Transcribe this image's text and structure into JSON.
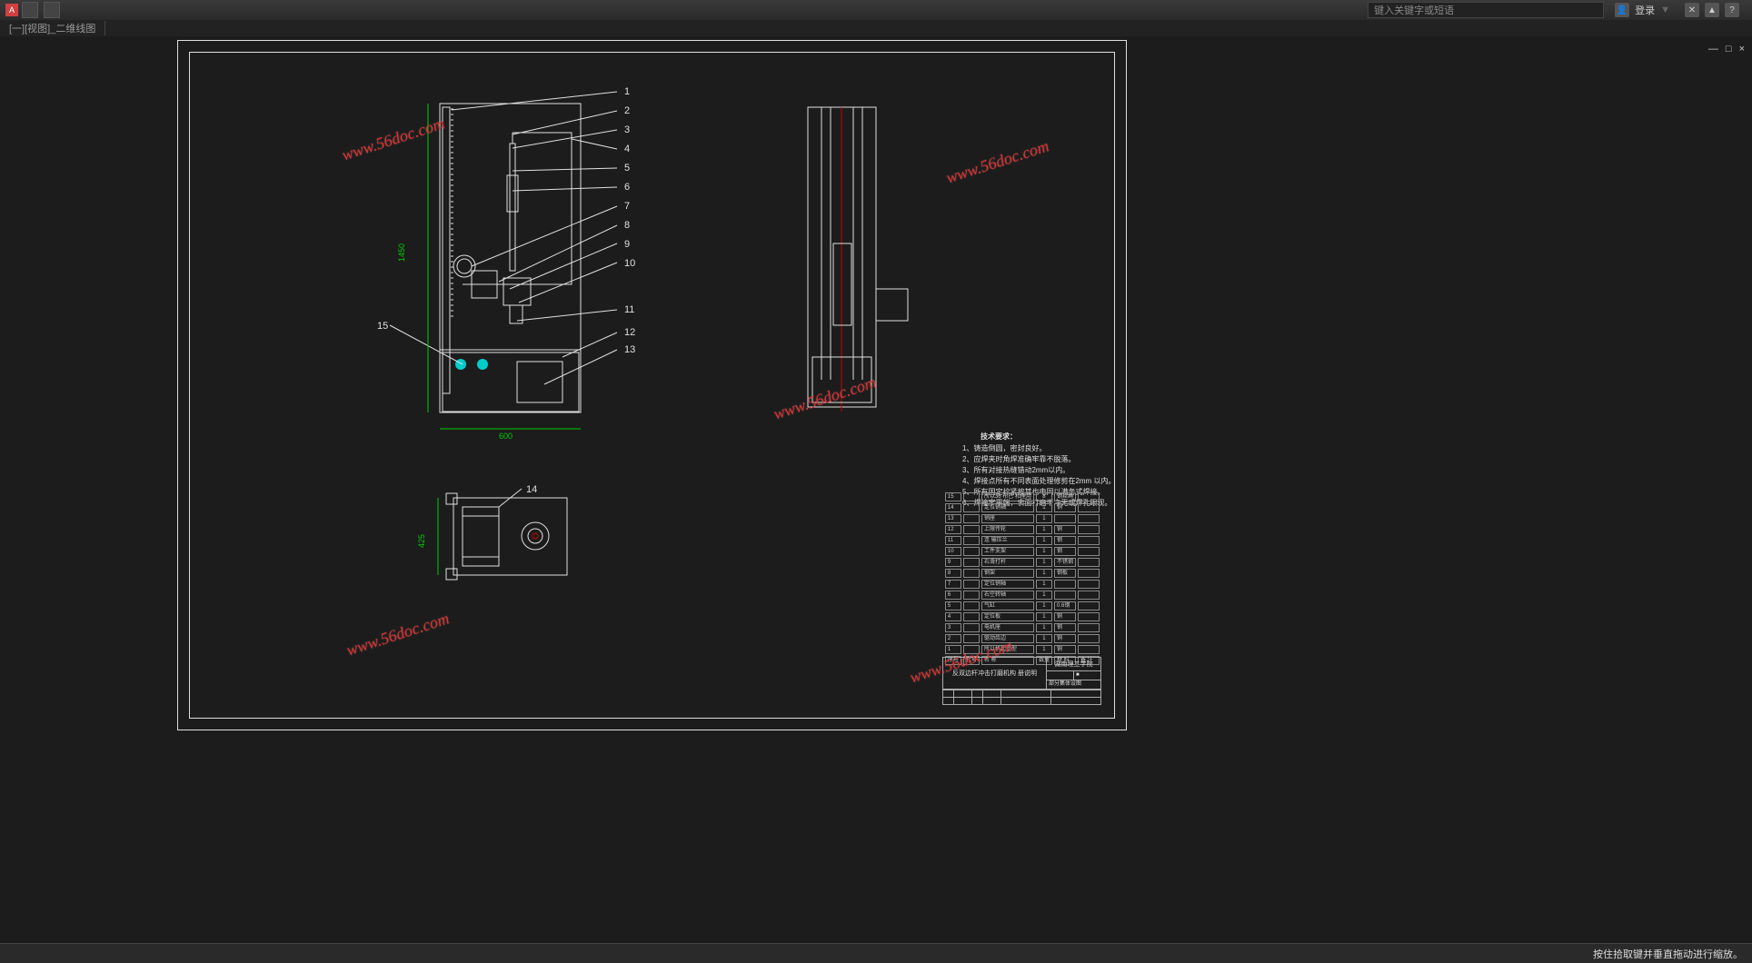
{
  "titlebar": {
    "app_initial": "A"
  },
  "search": {
    "placeholder": "键入关键字或短语"
  },
  "user": {
    "login_label": "登录"
  },
  "help_icon": "?",
  "file_tab": "[一][视图]_二维线图",
  "window_controls": {
    "minimize": "—",
    "maximize": "□",
    "close": "×"
  },
  "drawing": {
    "labels": {
      "l1": "1",
      "l2": "2",
      "l3": "3",
      "l4": "4",
      "l5": "5",
      "l6": "6",
      "l7": "7",
      "l8": "8",
      "l9": "9",
      "l10": "10",
      "l11": "11",
      "l12": "12",
      "l13": "13",
      "l14": "14",
      "l15": "15"
    },
    "dims": {
      "d600": "600",
      "d1450": "1450",
      "d425": "425"
    }
  },
  "notes": {
    "title": "技术要求：",
    "n1": "1、铸造倒圆，密封良好。",
    "n2": "2、应焊夹时角焊准确牢靠不脱落。",
    "n3": "3、所有对接热缝错动2mm以内。",
    "n4": "4、焊接点所有不同表面处理修剪在2mm 以内。",
    "n5": "5、所有固定拧紧按其也电同以满务式焊接。",
    "n6": "6、焊接牢平端，表面打磨干净无或焊孔眼现。"
  },
  "parts": [
    {
      "no": "15",
      "name": "所以36 布巴 和座用",
      "qty": "8",
      "mat": "钢丝绳"
    },
    {
      "no": "14",
      "name": "定位销轴",
      "qty": "1",
      "mat": "铜"
    },
    {
      "no": "13",
      "name": "销座",
      "qty": "1",
      "mat": ""
    },
    {
      "no": "12",
      "name": "上限传轮",
      "qty": "1",
      "mat": "铜"
    },
    {
      "no": "11",
      "name": "连 输压兰",
      "qty": "1",
      "mat": "钢"
    },
    {
      "no": "10",
      "name": "工件支架",
      "qty": "1",
      "mat": "钢"
    },
    {
      "no": "9",
      "name": "右滑打杆",
      "qty": "1",
      "mat": "不锈钢"
    },
    {
      "no": "8",
      "name": "钢架",
      "qty": "1",
      "mat": "钢板"
    },
    {
      "no": "7",
      "name": "定位销轴",
      "qty": "1",
      "mat": ""
    },
    {
      "no": "6",
      "name": "右空转轴",
      "qty": "1",
      "mat": ""
    },
    {
      "no": "5",
      "name": "气缸",
      "qty": "1",
      "mat": "0.6钢"
    },
    {
      "no": "4",
      "name": "定位板",
      "qty": "1",
      "mat": "铜"
    },
    {
      "no": "3",
      "name": "电机座",
      "qty": "1",
      "mat": "钢"
    },
    {
      "no": "2",
      "name": "驱动齿边",
      "qty": "1",
      "mat": "铜"
    },
    {
      "no": "1",
      "name": "所以机起定型",
      "qty": "1",
      "mat": "铜"
    }
  ],
  "parts_header": {
    "no": "序号",
    "code": "代号",
    "name": "名 称",
    "qty": "数量",
    "mat": "材 料",
    "note": "备 注"
  },
  "title_block": {
    "project_name": "反双边杆冲击打磨机构 册说明",
    "school": "湖南理工学院",
    "sub": "部分集体设图"
  },
  "watermark_text": "www.56doc.com",
  "status": {
    "hint": "按住拾取键并垂直拖动进行缩放。"
  }
}
